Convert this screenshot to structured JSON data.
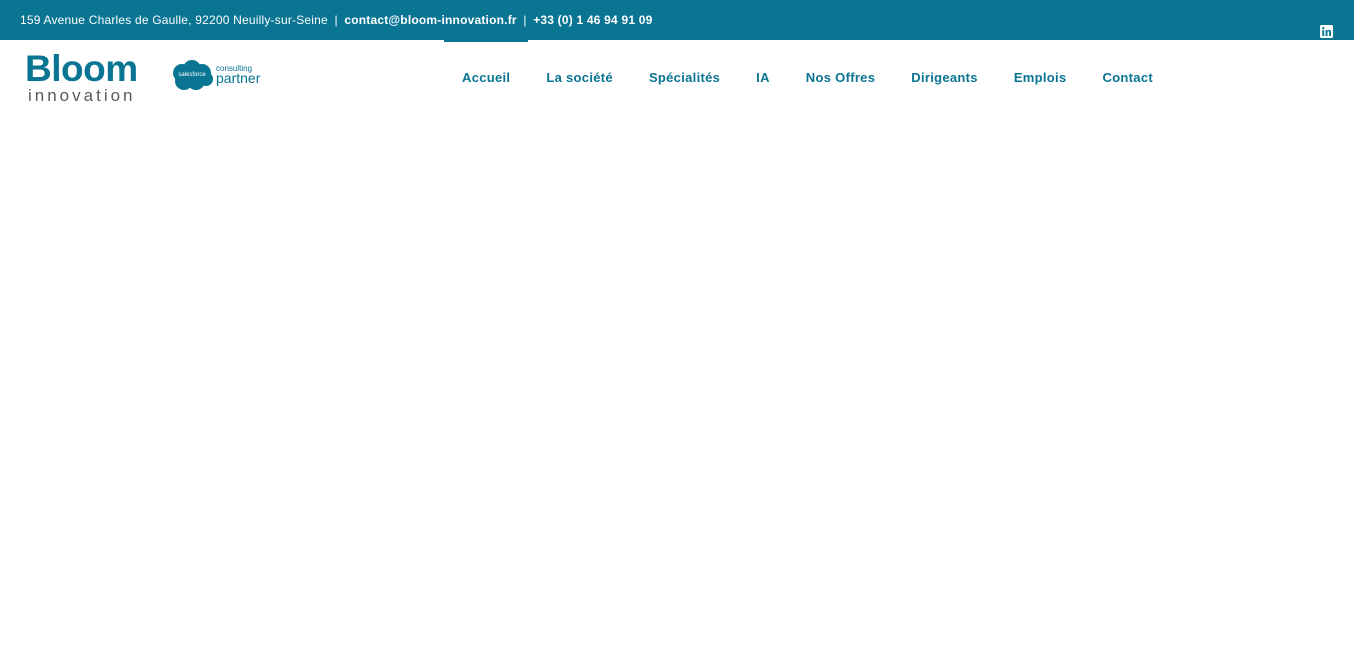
{
  "topbar": {
    "address": "159 Avenue Charles de Gaulle, 92200 Neuilly-sur-Seine",
    "separator": "|",
    "email": "contact@bloom-innovation.fr",
    "phone": "+33 (0) 1 46 94 91 09",
    "social_icon": "linkedin-icon"
  },
  "header": {
    "logo_main": "Bloom",
    "logo_sub": "innovation",
    "partner_cloud_label": "salesforce",
    "partner_consulting": "consulting",
    "partner_label": "partner"
  },
  "nav": {
    "items": [
      {
        "label": "Accueil",
        "active": true
      },
      {
        "label": "La société",
        "active": false
      },
      {
        "label": "Spécialités",
        "active": false
      },
      {
        "label": "IA",
        "active": false
      },
      {
        "label": "Nos Offres",
        "active": false
      },
      {
        "label": "Dirigeants",
        "active": false
      },
      {
        "label": "Emplois",
        "active": false
      },
      {
        "label": "Contact",
        "active": false
      }
    ]
  },
  "colors": {
    "brand": "#0a7493",
    "logo_sub": "#555c61",
    "background": "#ffffff"
  }
}
